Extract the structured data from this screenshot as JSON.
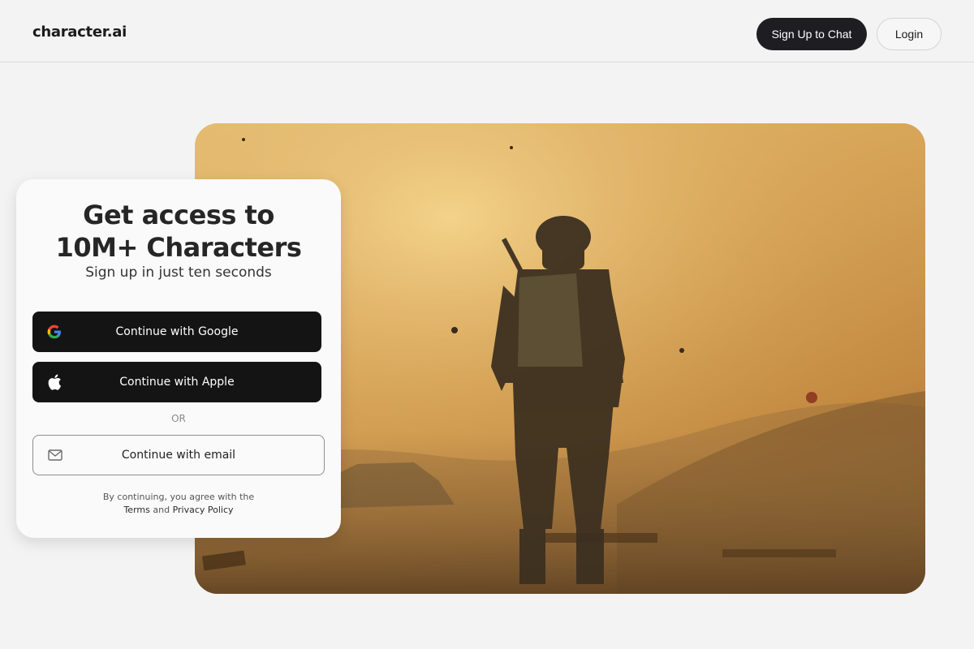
{
  "header": {
    "logo": "character.ai",
    "signup_label": "Sign Up to Chat",
    "login_label": "Login"
  },
  "card": {
    "title_line1": "Get access to",
    "title_line2": "10M+ Characters",
    "subtitle": "Sign up in just ten seconds",
    "google_label": "Continue with Google",
    "apple_label": "Continue with Apple",
    "or_label": "OR",
    "email_label": "Continue with email",
    "legal_line1": "By continuing, you agree with the",
    "terms_label": "Terms",
    "and_label": "and",
    "privacy_label": "Privacy Policy"
  },
  "icons": {
    "google": "google-icon",
    "apple": "apple-icon",
    "email": "mail-icon"
  },
  "colors": {
    "primary_button": "#1e1e22",
    "oauth_button": "#141414",
    "background": "#f3f3f3",
    "hero_tone": "#d9a85a"
  }
}
